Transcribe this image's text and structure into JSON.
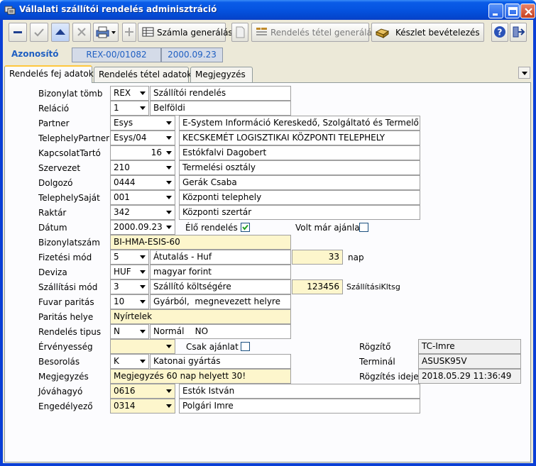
{
  "window": {
    "title": "Vállalati szállítói rendelés adminisztráció"
  },
  "toolbar": {
    "invoice_label": "Számla generálás",
    "item_gen_label": "Rendelés tétel generálás",
    "stock_label": "Készlet bevételezés"
  },
  "header": {
    "id_label": "Azonosító",
    "id_value": "REX-00/01082",
    "date_value": "2000.09.23"
  },
  "tabs": [
    "Rendelés fej adatok",
    "Rendelés tétel adatok",
    "Megjegyzés"
  ],
  "form": {
    "bizonylat_tomb": {
      "label": "Bizonylat tömb",
      "code": "REX",
      "desc": "Szállítói rendelés"
    },
    "relacio": {
      "label": "Reláció",
      "code": "1",
      "desc": "Belföldi"
    },
    "partner": {
      "label": "Partner",
      "code": "Esys",
      "desc": "E-System Információ Kereskedő, Szolgáltató és Termelő Beté"
    },
    "telephely_partner": {
      "label": "TelephelyPartner",
      "code": "Esys/04",
      "desc": "KECSKEMÉT LOGISZTIKAI KÖZPONTI TELEPHELY"
    },
    "kapcsolattarto": {
      "label": "KapcsolatTartó",
      "code": "16",
      "desc": "Estókfalvi Dagobert"
    },
    "szervezet": {
      "label": "Szervezet",
      "code": "210",
      "desc": "Termelési osztály"
    },
    "dolgozo": {
      "label": "Dolgozó",
      "code": "0444",
      "desc": "Gerák Csaba"
    },
    "telephely_sajat": {
      "label": "TelephelySaját",
      "code": "001",
      "desc": "Központi telephely"
    },
    "raktar": {
      "label": "Raktár",
      "code": "342",
      "desc": "Központi szertár"
    },
    "datum": {
      "label": "Dátum",
      "value": "2000.09.23"
    },
    "elo_rendeles": {
      "label": "Élő rendelés",
      "checked": true
    },
    "volt_ajanlat": {
      "label": "Volt már ajánlat",
      "checked": false
    },
    "bizonylatszam": {
      "label": "Bizonylatszám",
      "value": "BI-HMA-ESIS-60"
    },
    "fizetesi_mod": {
      "label": "Fizetési mód",
      "code": "5",
      "desc": "Átutalás - Huf",
      "days": "33",
      "unit": "nap"
    },
    "deviza": {
      "label": "Deviza",
      "code": "HUF",
      "desc": "magyar forint"
    },
    "szallitasi_mod": {
      "label": "Szállítási mód",
      "code": "3",
      "desc": "Szállító költségére",
      "amount": "123456",
      "amount_label": "SzállításiKltsg"
    },
    "fuvar_paritas": {
      "label": "Fuvar paritás",
      "code": "10",
      "desc": "Gyárból,  megnevezett helyre"
    },
    "paritas_helye": {
      "label": "Paritás helye",
      "value": "Nyírtelek"
    },
    "rendeles_tipus": {
      "label": "Rendelés tipus",
      "code": "N",
      "desc": "Normál    NO"
    },
    "ervenyesseg": {
      "label": "Érvényesség",
      "value": ""
    },
    "csak_ajanlat": {
      "label": "Csak ajánlat",
      "checked": false
    },
    "besorolas": {
      "label": "Besorolás",
      "code": "K",
      "desc": "Katonai gyártás"
    },
    "megjegyzes": {
      "label": "Megjegyzés",
      "value": "Megjegyzés 60 nap helyett 30!"
    },
    "jovahagyo": {
      "label": "Jóváhagyó",
      "code": "0616",
      "desc": "Estók István"
    },
    "engedelyezo": {
      "label": "Engedélyező",
      "code": "0314",
      "desc": "Polgári Imre"
    },
    "rogzito": {
      "label": "Rögzítő",
      "value": "TC-Imre"
    },
    "terminal": {
      "label": "Terminál",
      "value": "ASUSK95V"
    },
    "rogzites_ideje": {
      "label": "Rögzítés ideje",
      "value": "2018.05.29 11:36:49"
    }
  }
}
